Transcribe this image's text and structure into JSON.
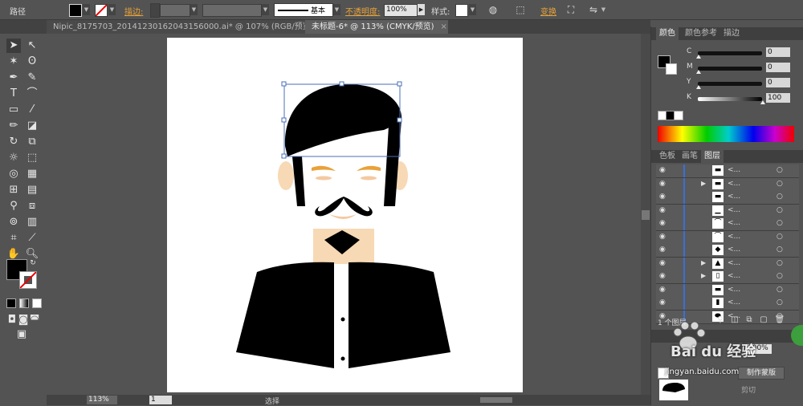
{
  "control_bar": {
    "object_type": "路径",
    "stroke_label": "描边:",
    "stroke_profile": "基本",
    "opacity_label": "不透明度:",
    "opacity_value": "100%",
    "style_label": "样式:",
    "transform_label": "变换"
  },
  "tabs": [
    {
      "title": "Nipic_8175703_20141230162043156000.ai* @ 107% (RGB/预览)",
      "close": "×"
    },
    {
      "title": "未标题-6* @ 113% (CMYK/预览)",
      "close": "×"
    }
  ],
  "color_panel": {
    "tabs": [
      "颜色",
      "颜色参考",
      "描边"
    ],
    "channels": [
      {
        "name": "C",
        "value": "0",
        "level": 0
      },
      {
        "name": "M",
        "value": "0",
        "level": 0
      },
      {
        "name": "Y",
        "value": "0",
        "level": 0
      },
      {
        "name": "K",
        "value": "100",
        "level": 1
      }
    ]
  },
  "layers_panel": {
    "tabs": [
      "色板",
      "画笔",
      "图层"
    ],
    "rows": [
      {
        "name": "<...",
        "expand": ""
      },
      {
        "name": "<...",
        "expand": "▶"
      },
      {
        "name": "<...",
        "expand": ""
      },
      {
        "name": "<...",
        "expand": ""
      },
      {
        "name": "<...",
        "expand": ""
      },
      {
        "name": "<...",
        "expand": ""
      },
      {
        "name": "<...",
        "expand": ""
      },
      {
        "name": "<...",
        "expand": "▶"
      },
      {
        "name": "<...",
        "expand": "▶"
      },
      {
        "name": "<...",
        "expand": ""
      },
      {
        "name": "<...",
        "expand": ""
      },
      {
        "name": "<...",
        "expand": ""
      }
    ],
    "footer": "1 个图层"
  },
  "transparency_panel": {
    "opacity_value": "100%",
    "make_mask": "制作蒙版",
    "clip": "剪切"
  },
  "status_bar": {
    "zoom": "113%",
    "page": "1",
    "tool": "选择"
  },
  "watermark": {
    "brand": "Bai du 经验",
    "url": "jingyan.baidu.com"
  },
  "colors": {
    "panel_bg": "#535353",
    "accent_orange": "#e8a23a",
    "selection_blue": "#4a6fb5",
    "skin": "#f7d9b5"
  }
}
